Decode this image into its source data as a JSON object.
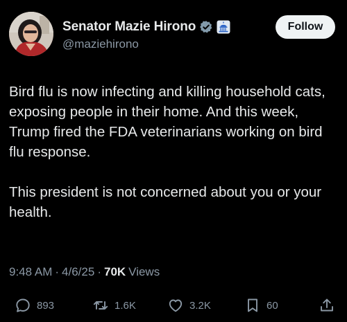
{
  "post": {
    "author": {
      "display_name": "Senator Mazie Hirono",
      "handle": "@maziehirono",
      "verified_icon": "verified-badge-icon",
      "affiliation_icon": "capitol-badge-icon"
    },
    "follow_label": "Follow",
    "paragraphs": [
      "Bird flu is now infecting and killing household cats, exposing people in their home. And this week, Trump fired the FDA veterinarians working on bird flu response.",
      "This president is not concerned about you or your health."
    ],
    "time": "9:48 AM",
    "date": "4/6/25",
    "views_count": "70K",
    "views_label": "Views",
    "separator": "·"
  },
  "actions": {
    "replies": "893",
    "reposts": "1.6K",
    "likes": "3.2K",
    "bookmarks": "60"
  },
  "colors": {
    "background": "#000000",
    "text": "#e7e9ea",
    "secondary_text": "#8b98a5",
    "verified_badge": "#829aab",
    "follow_button": "#eff3f4"
  }
}
